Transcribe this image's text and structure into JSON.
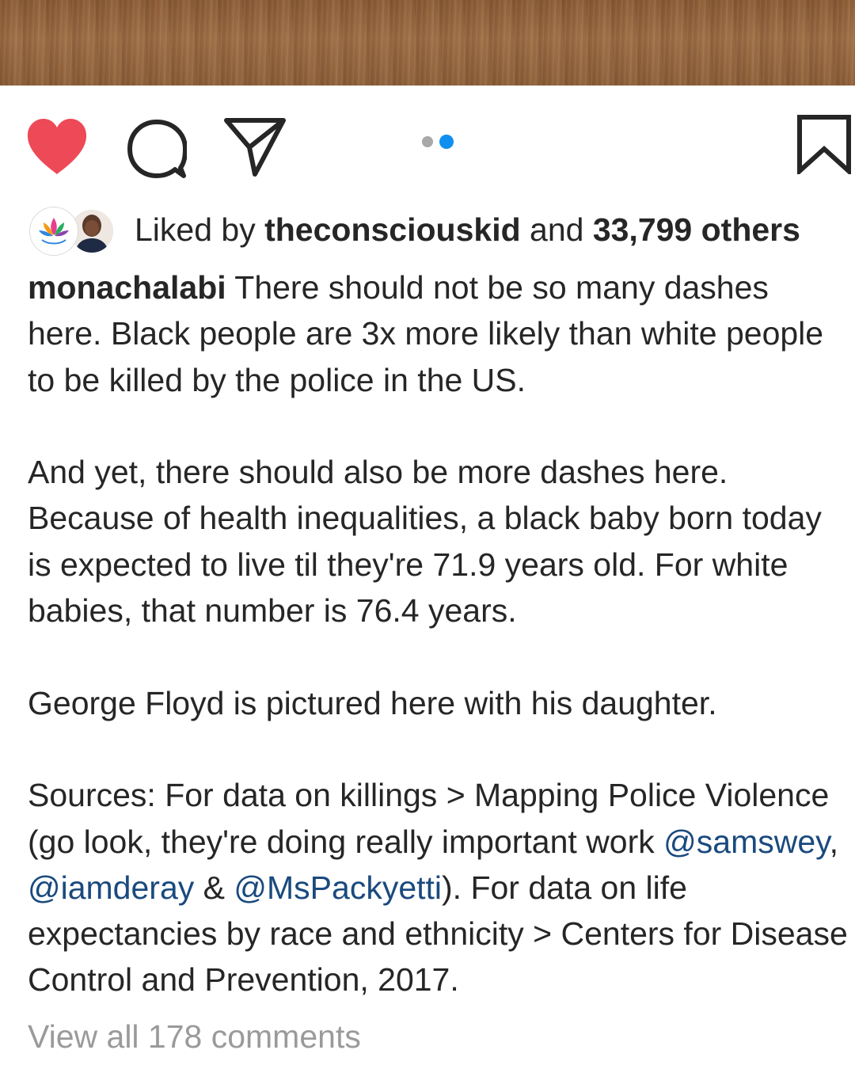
{
  "post_image": {
    "description_icon": "wood-texture-photo"
  },
  "actions": {
    "like_icon": "heart-filled-icon",
    "like_color": "#ed4956",
    "comment_icon": "comment-icon",
    "share_icon": "paper-plane-icon",
    "save_icon": "bookmark-icon",
    "carousel": {
      "total": 2,
      "active_index": 1,
      "active_color": "#0f8ff0",
      "inactive_color": "#a8a8a8"
    }
  },
  "likes": {
    "prefix": "Liked by ",
    "first_user": "theconsciouskid",
    "middle": " and ",
    "others": "33,799 others"
  },
  "caption": {
    "username": "monachalabi",
    "p1": " There should not be so many dashes here. Black people are 3x more likely than white people to be killed by the police in the US.",
    "p2": "And yet, there should also be more dashes here. Because of health inequalities, a black baby born today is expected to live til they're 71.9 years old. For white babies, that number is 76.4 years.",
    "p3": "George Floyd is pictured here with his daughter.",
    "p4_a": "Sources: For data on killings > Mapping Police Violence (go look, they're doing really important work ",
    "mention1": "@samswey",
    "sep1": ", ",
    "mention2": "@iamderay",
    "sep2": " & ",
    "mention3": "@MsPackyetti",
    "p4_b": "). For data on life expectancies by race and ethnicity > Centers for Disease Control and Prevention, 2017.",
    "mention_color": "#1a4a7e"
  },
  "comments": {
    "view_all": "View all 178 comments"
  }
}
